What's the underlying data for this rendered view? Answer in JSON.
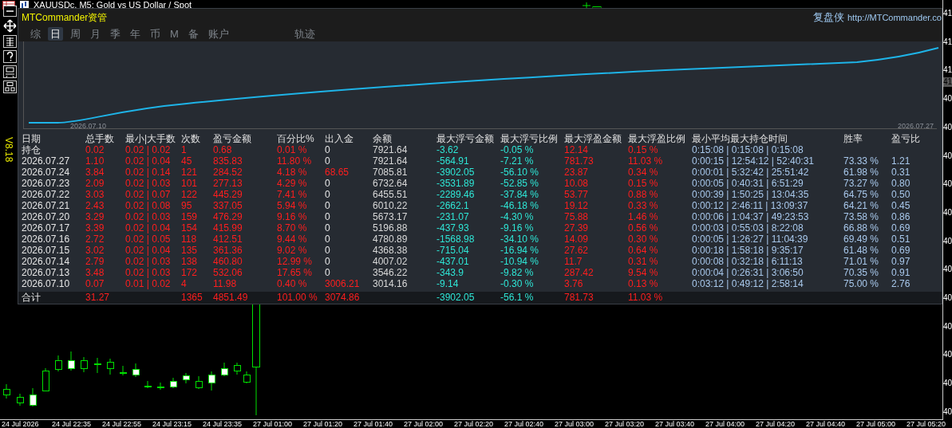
{
  "window": {
    "title": "XAUUSDc, M5:  Gold vs US Dollar / Spot"
  },
  "version": "V8.18",
  "panel": {
    "title": "MTCommander资管",
    "brand": "复盘侠",
    "link": "http://MTCommander.co",
    "tabs": [
      {
        "label": "综",
        "selected": false
      },
      {
        "label": "日",
        "selected": true
      },
      {
        "label": "周",
        "selected": false
      },
      {
        "label": "月",
        "selected": false
      },
      {
        "label": "季",
        "selected": false
      },
      {
        "label": "年",
        "selected": false
      },
      {
        "label": "币",
        "selected": false
      },
      {
        "label": "M",
        "selected": false
      },
      {
        "label": "备",
        "selected": false
      },
      {
        "label": "账户",
        "selected": false
      },
      {
        "label": "轨迹",
        "selected": false
      }
    ],
    "equity_chart": {
      "start_label": "2026.07.10",
      "end_label": "2026.07.27"
    },
    "table": {
      "columns": [
        "日期",
        "总手数",
        "最小|大手数",
        "次数",
        "盈亏金额",
        "百分比%",
        "出入金",
        "余额",
        "最大浮亏金额",
        "最大浮亏比例",
        "最大浮盈金额",
        "最大浮盈比例",
        "最小平均最大持仓时间",
        "胜率",
        "盈亏比"
      ],
      "rows": [
        {
          "cells": [
            "持仓",
            "0.02",
            "0.02 | 0.02",
            "1",
            "0.68",
            "0.01 %",
            "0",
            "7921.64",
            "-3.62",
            "-0.05 %",
            "12.14",
            "0.15 %",
            "0:15:08 | 0:15:08 | 0:15:08",
            null,
            null
          ],
          "deposit_red": false
        },
        {
          "cells": [
            "2026.07.27",
            "1.10",
            "0.02 | 0.04",
            "45",
            "835.83",
            "11.80 %",
            "0",
            "7921.64",
            "-564.91",
            "-7.21 %",
            "781.73",
            "11.03 %",
            "0:00:15 | 12:54:12 | 52:40:31",
            "73.33 %",
            "1.21"
          ],
          "deposit_red": false
        },
        {
          "cells": [
            "2026.07.24",
            "3.84",
            "0.02 | 0.14",
            "121",
            "284.52",
            "4.18 %",
            "68.65",
            "7085.81",
            "-3902.05",
            "-56.10 %",
            "23.87",
            "0.34 %",
            "0:00:01 | 5:32:42 | 25:51:42",
            "61.98 %",
            "0.31"
          ],
          "deposit_red": true
        },
        {
          "cells": [
            "2026.07.23",
            "2.09",
            "0.02 | 0.03",
            "101",
            "277.13",
            "4.29 %",
            "0",
            "6732.64",
            "-3531.89",
            "-52.85 %",
            "10.08",
            "0.15 %",
            "0:00:05 | 0:40:31 | 6:51:29",
            "73.27 %",
            "0.80"
          ],
          "deposit_red": false
        },
        {
          "cells": [
            "2026.07.22",
            "3.03",
            "0.02 | 0.07",
            "122",
            "445.29",
            "7.41 %",
            "0",
            "6455.51",
            "-2289.46",
            "-37.84 %",
            "53.77",
            "0.88 %",
            "0:00:39 | 1:50:25 | 13:04:35",
            "64.75 %",
            "0.50"
          ],
          "deposit_red": false
        },
        {
          "cells": [
            "2026.07.21",
            "2.43",
            "0.02 | 0.08",
            "95",
            "337.05",
            "5.94 %",
            "0",
            "6010.22",
            "-2662.1",
            "-46.18 %",
            "19.12",
            "0.33 %",
            "0:00:12 | 2:46:11 | 13:09:37",
            "64.21 %",
            "0.45"
          ],
          "deposit_red": false
        },
        {
          "cells": [
            "2026.07.20",
            "3.29",
            "0.02 | 0.03",
            "159",
            "476.29",
            "9.16 %",
            "0",
            "5673.17",
            "-231.07",
            "-4.30 %",
            "75.88",
            "1.46 %",
            "0:00:06 | 1:04:37 | 49:23:53",
            "73.58 %",
            "0.86"
          ],
          "deposit_red": false
        },
        {
          "cells": [
            "2026.07.17",
            "3.39",
            "0.02 | 0.04",
            "154",
            "415.99",
            "8.70 %",
            "0",
            "5196.88",
            "-437.93",
            "-9.16 %",
            "27.39",
            "0.56 %",
            "0:00:03 | 0:55:03 | 8:22:08",
            "66.88 %",
            "0.69"
          ],
          "deposit_red": false
        },
        {
          "cells": [
            "2026.07.16",
            "2.72",
            "0.02 | 0.05",
            "118",
            "412.51",
            "9.44 %",
            "0",
            "4780.89",
            "-1568.98",
            "-34.10 %",
            "14.09",
            "0.30 %",
            "0:00:05 | 1:26:27 | 11:04:39",
            "69.49 %",
            "0.51"
          ],
          "deposit_red": false
        },
        {
          "cells": [
            "2026.07.15",
            "3.02",
            "0.02 | 0.04",
            "135",
            "361.36",
            "9.02 %",
            "0",
            "4368.38",
            "-715.04",
            "-16.94 %",
            "27.62",
            "0.64 %",
            "0:00:18 | 1:58:18 | 9:35:17",
            "61.48 %",
            "0.69"
          ],
          "deposit_red": false
        },
        {
          "cells": [
            "2026.07.14",
            "2.79",
            "0.02 | 0.03",
            "138",
            "460.80",
            "12.99 %",
            "0",
            "4007.02",
            "-437.01",
            "-10.94 %",
            "11.7",
            "0.31 %",
            "0:00:08 | 0:32:18 | 6:11:13",
            "71.01 %",
            "0.97"
          ],
          "deposit_red": false
        },
        {
          "cells": [
            "2026.07.13",
            "3.48",
            "0.02 | 0.03",
            "172",
            "532.06",
            "17.65 %",
            "0",
            "3546.22",
            "-343.9",
            "-9.82 %",
            "287.42",
            "9.54 %",
            "0:00:04 | 0:26:31 | 3:06:50",
            "70.35 %",
            "0.91"
          ],
          "deposit_red": false
        },
        {
          "cells": [
            "2026.07.10",
            "0.07",
            "0.01 | 0.02",
            "4",
            "11.98",
            "0.40 %",
            "3006.21",
            "3014.16",
            "-9.14",
            "-0.30 %",
            "3.76",
            "0.13 %",
            "0:03:12 | 0:49:12 | 2:58:14",
            "75.00 %",
            "2.76"
          ],
          "deposit_red": true
        }
      ],
      "total": {
        "cells": [
          "合计",
          "31.27",
          null,
          "1365",
          "4851.49",
          "101.00 %",
          "3074.86",
          null,
          "-3902.05",
          "-56.1 %",
          "781.73",
          "11.03 %",
          null,
          null,
          null
        ],
        "deposit_red": true
      }
    }
  },
  "price_axis": [
    "41",
    "41",
    "41",
    "40",
    "40",
    "40",
    "40",
    "40",
    "40",
    "40",
    "40",
    "40",
    "40",
    "40",
    "40"
  ],
  "current_price": "41",
  "time_axis": [
    "24 Jul 2026",
    "24 Jul 22:35",
    "24 Jul 22:55",
    "24 Jul 23:15",
    "24 Jul 23:35",
    "27 Jul 01:00",
    "27 Jul 01:20",
    "27 Jul 01:40",
    "27 Jul 02:00",
    "27 Jul 02:20",
    "27 Jul 02:40",
    "27 Jul 03:00",
    "27 Jul 03:20",
    "27 Jul 03:40",
    "27 Jul 04:00",
    "27 Jul 04:20",
    "27 Jul 04:40",
    "27 Jul 05:00",
    "27 Jul 05:20"
  ]
}
